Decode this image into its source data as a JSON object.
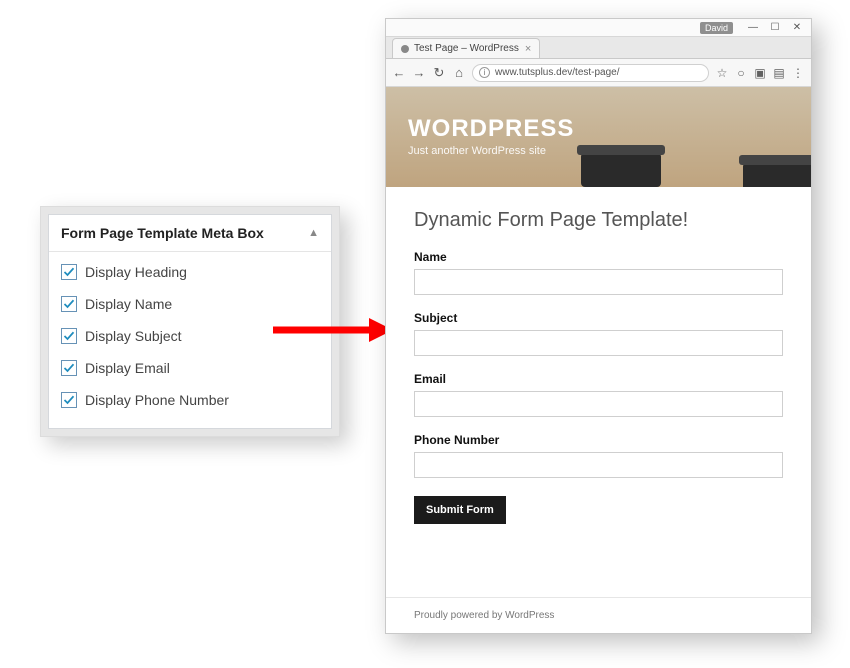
{
  "metabox": {
    "title": "Form Page Template Meta Box",
    "items": [
      {
        "label": "Display Heading",
        "checked": true
      },
      {
        "label": "Display Name",
        "checked": true
      },
      {
        "label": "Display Subject",
        "checked": true
      },
      {
        "label": "Display Email",
        "checked": true
      },
      {
        "label": "Display Phone Number",
        "checked": true
      }
    ]
  },
  "browser": {
    "user_pill": "David",
    "tab_title": "Test Page – WordPress",
    "url": "www.tutsplus.dev/test-page/"
  },
  "site": {
    "title": "WORDPRESS",
    "tagline": "Just another WordPress site"
  },
  "page": {
    "heading": "Dynamic Form Page Template!",
    "fields": {
      "name": {
        "label": "Name",
        "value": ""
      },
      "subject": {
        "label": "Subject",
        "value": ""
      },
      "email": {
        "label": "Email",
        "value": ""
      },
      "phone": {
        "label": "Phone Number",
        "value": ""
      }
    },
    "submit_label": "Submit Form"
  },
  "footer": {
    "text": "Proudly powered by WordPress"
  }
}
